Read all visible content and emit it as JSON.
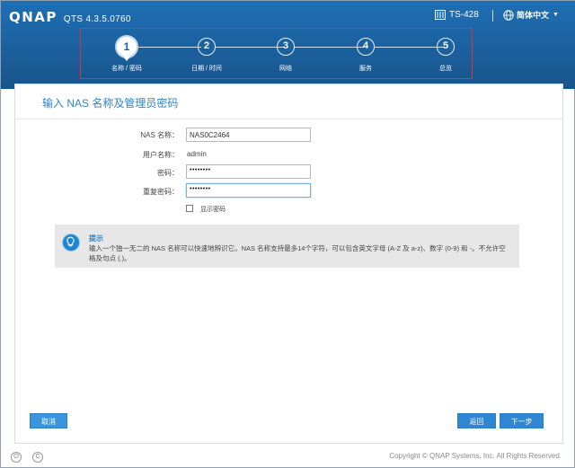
{
  "header": {
    "logo": "QNAP",
    "version": "QTS 4.3.5.0760",
    "model": "TS-428",
    "language": "简体中文",
    "icons": [
      "server-icon",
      "globe-icon",
      "caret-down-icon"
    ]
  },
  "steps": [
    {
      "num": "1",
      "label": "名称 / 密码",
      "active": true
    },
    {
      "num": "2",
      "label": "日期 / 时间",
      "active": false
    },
    {
      "num": "3",
      "label": "网络",
      "active": false
    },
    {
      "num": "4",
      "label": "服务",
      "active": false
    },
    {
      "num": "5",
      "label": "总览",
      "active": false
    }
  ],
  "form": {
    "title": "输入 NAS 名称及管理员密码",
    "nas_name_label": "NAS 名称：",
    "nas_name_value": "NAS0C2464",
    "username_label": "用户名称：",
    "username_value": "admin",
    "password_label": "密码：",
    "password_value": "••••••••",
    "confirm_label": "重复密码：",
    "confirm_value": "••••••••",
    "show_password_label": "显示密码",
    "show_password_checked": false
  },
  "tip": {
    "icon": "lightbulb-icon",
    "title": "提示",
    "body": "输入一个独一无二的 NAS 名称可以快速地辨识它。NAS 名称支持最多14个字符，可以包含英文字母 (A-Z 及 a-z)、数字 (0-9) 和 -。不允许空格及句点 (.)。"
  },
  "buttons": {
    "cancel": "取消",
    "back": "返回",
    "next": "下一步"
  },
  "footer": {
    "copyright": "Copyright © QNAP Systems, Inc. All Rights Reserved.",
    "icons": [
      "power-icon",
      "restart-icon"
    ]
  },
  "colors": {
    "header": "#1b5f9c",
    "accent": "#2e84c8",
    "highlight_frame": "#e0313b",
    "button": "#3a95de"
  }
}
